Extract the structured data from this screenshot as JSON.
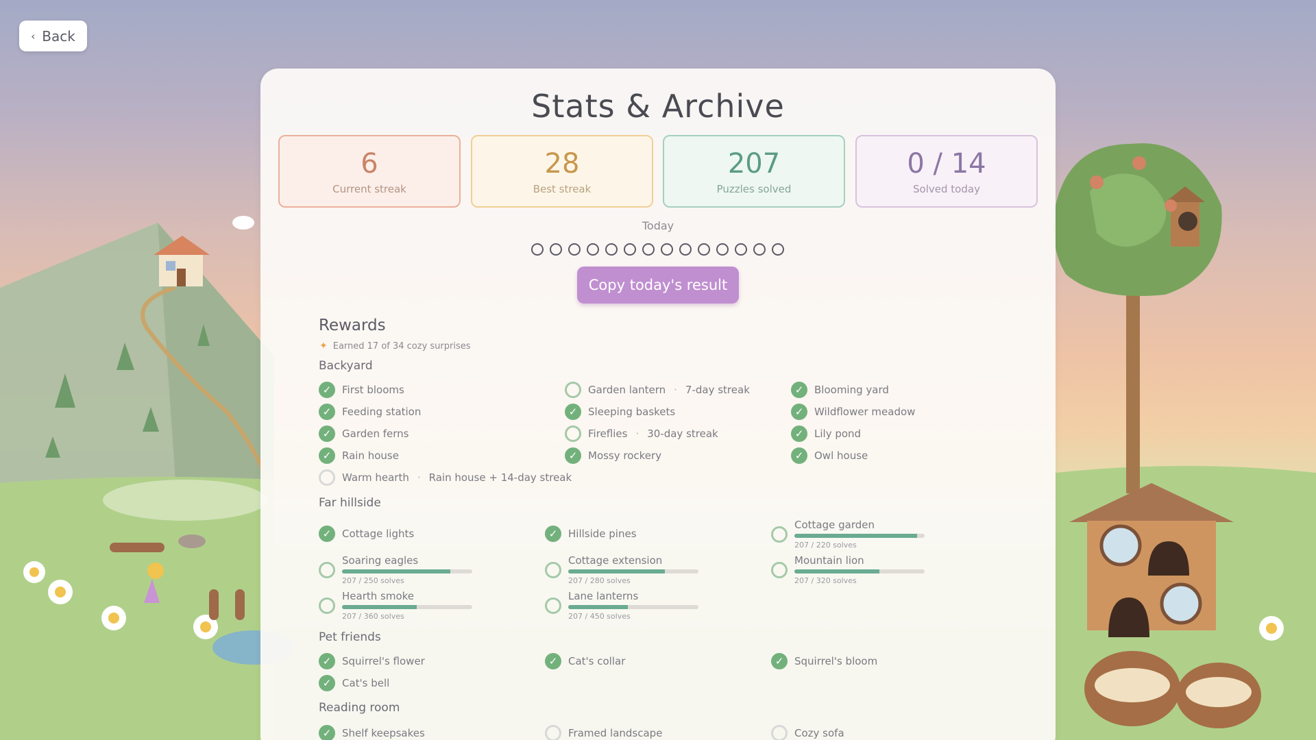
{
  "back": {
    "label": "Back"
  },
  "title": "Stats & Archive",
  "stats": [
    {
      "value": "6",
      "label": "Current streak"
    },
    {
      "value": "28",
      "label": "Best streak"
    },
    {
      "value": "207",
      "label": "Puzzles solved"
    },
    {
      "value": "0 / 14",
      "label": "Solved today"
    }
  ],
  "today_label": "Today",
  "today_dots": 14,
  "copy_label": "Copy today's result",
  "rewards": {
    "title": "Rewards",
    "earned": "Earned 17 of 34 cozy surprises",
    "sections": [
      {
        "name": "Backyard",
        "items": [
          {
            "name": "First blooms",
            "done": true
          },
          {
            "name": "Garden lantern",
            "req": "7-day streak",
            "done": false
          },
          {
            "name": "Blooming yard",
            "done": true
          },
          {
            "name": "Feeding station",
            "done": true
          },
          {
            "name": "Sleeping baskets",
            "done": true
          },
          {
            "name": "Wildflower meadow",
            "done": true
          },
          {
            "name": "Garden ferns",
            "done": true
          },
          {
            "name": "Fireflies",
            "req": "30-day streak",
            "done": false
          },
          {
            "name": "Lily pond",
            "done": true
          },
          {
            "name": "Rain house",
            "done": true
          },
          {
            "name": "Mossy rockery",
            "done": true
          },
          {
            "name": "Owl house",
            "done": true
          },
          {
            "name": "Warm hearth",
            "req": "Rain house + 14-day streak",
            "done": false
          }
        ]
      },
      {
        "name": "Far hillside",
        "items": [
          {
            "name": "Cottage lights",
            "done": true
          },
          {
            "name": "Hillside pines",
            "done": true
          },
          {
            "name": "Cottage garden",
            "done": false,
            "progress": 0.94,
            "count": "207 / 220 solves"
          },
          {
            "name": "Soaring eagles",
            "done": false,
            "progress": 0.83,
            "count": "207 / 250 solves"
          },
          {
            "name": "Cottage extension",
            "done": false,
            "progress": 0.74,
            "count": "207 / 280 solves"
          },
          {
            "name": "Mountain lion",
            "done": false,
            "progress": 0.65,
            "count": "207 / 320 solves"
          },
          {
            "name": "Hearth smoke",
            "done": false,
            "progress": 0.575,
            "count": "207 / 360 solves"
          },
          {
            "name": "Lane lanterns",
            "done": false,
            "progress": 0.46,
            "count": "207 / 450 solves"
          }
        ]
      },
      {
        "name": "Pet friends",
        "items": [
          {
            "name": "Squirrel's flower",
            "done": true
          },
          {
            "name": "Cat's collar",
            "done": true
          },
          {
            "name": "Squirrel's bloom",
            "done": true
          },
          {
            "name": "Cat's bell",
            "done": true
          }
        ]
      },
      {
        "name": "Reading room",
        "items": [
          {
            "name": "Shelf keepsakes",
            "done": true
          },
          {
            "name": "Framed landscape",
            "done": false
          },
          {
            "name": "Cozy sofa",
            "done": false
          }
        ]
      }
    ]
  },
  "colors": {
    "accent": "#c08fd0",
    "check": "#73b17c",
    "progress": "#6aab92"
  }
}
